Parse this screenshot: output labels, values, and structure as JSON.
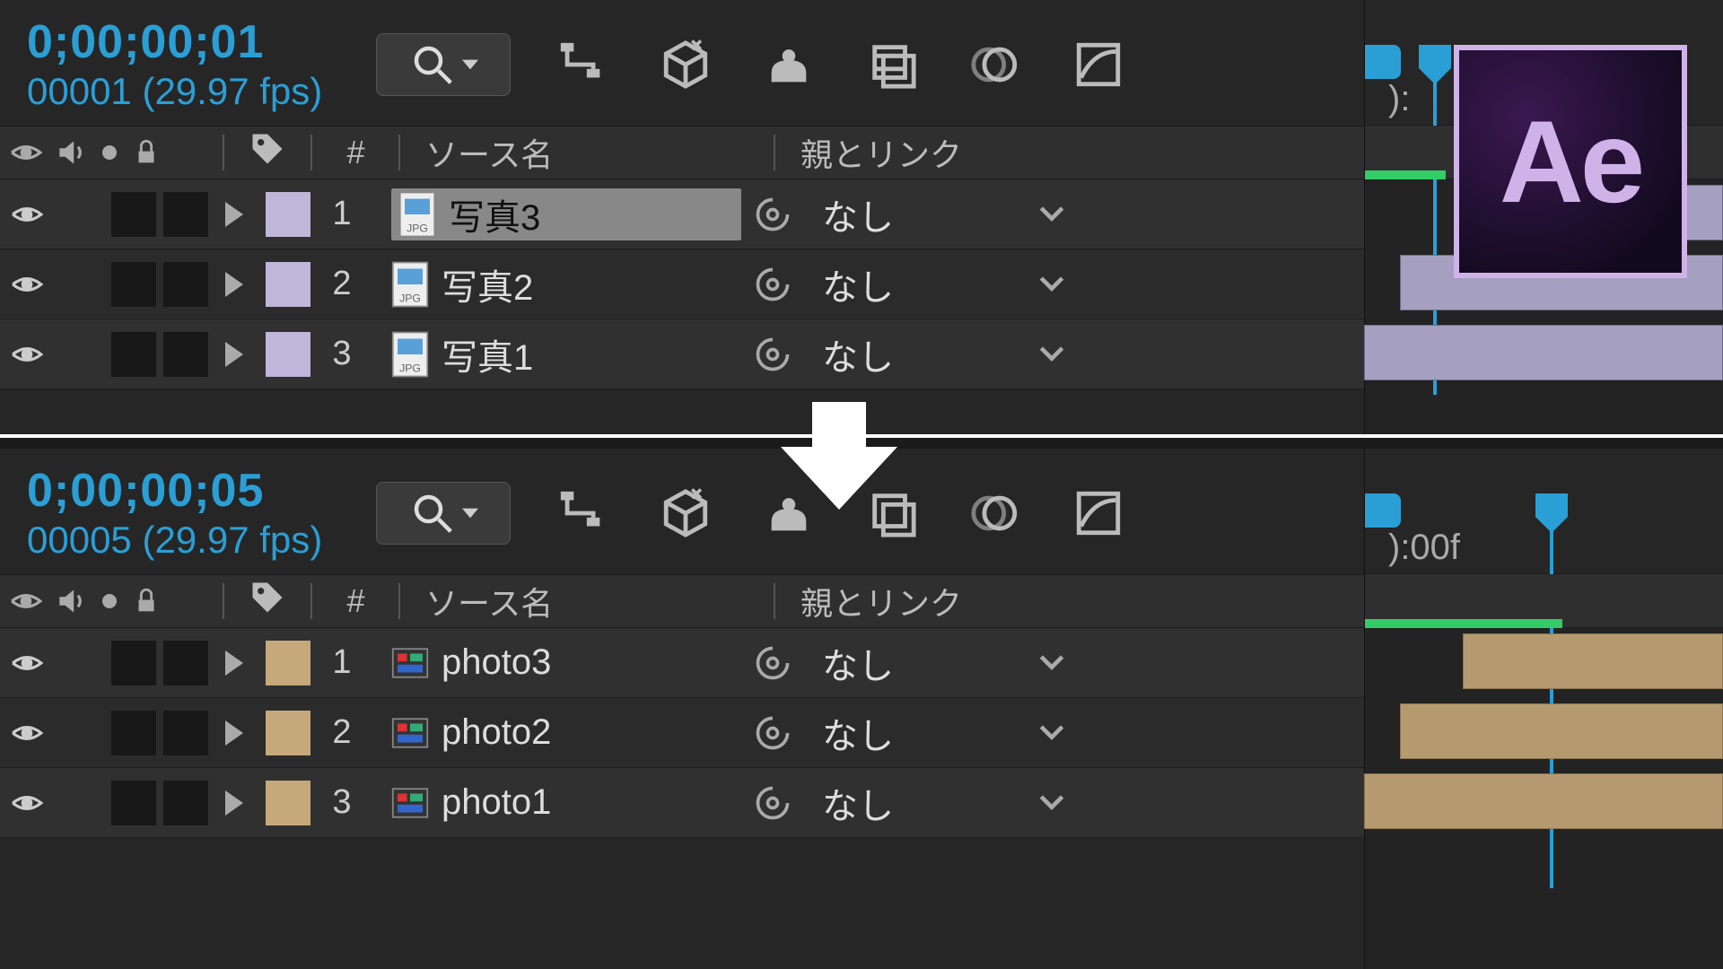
{
  "app_logo": "Ae",
  "top": {
    "timecode": "0;00;00;01",
    "frame_fps": "00001 (29.97 fps)",
    "ruler_label": "):",
    "columns": {
      "source": "ソース名",
      "parent": "親とリンク",
      "num": "#"
    },
    "layers": [
      {
        "index": "1",
        "name": "写真3",
        "parent": "なし",
        "selected": true,
        "color": "lavender"
      },
      {
        "index": "2",
        "name": "写真2",
        "parent": "なし",
        "selected": false,
        "color": "lavender"
      },
      {
        "index": "3",
        "name": "写真1",
        "parent": "なし",
        "selected": false,
        "color": "lavender"
      }
    ]
  },
  "bottom": {
    "timecode": "0;00;00;05",
    "frame_fps": "00005 (29.97 fps)",
    "ruler_label": "):00f",
    "columns": {
      "source": "ソース名",
      "parent": "親とリンク",
      "num": "#"
    },
    "layers": [
      {
        "index": "1",
        "name": "photo3",
        "parent": "なし",
        "color": "tan"
      },
      {
        "index": "2",
        "name": "photo2",
        "parent": "なし",
        "color": "tan"
      },
      {
        "index": "3",
        "name": "photo1",
        "parent": "なし",
        "color": "tan"
      }
    ]
  }
}
